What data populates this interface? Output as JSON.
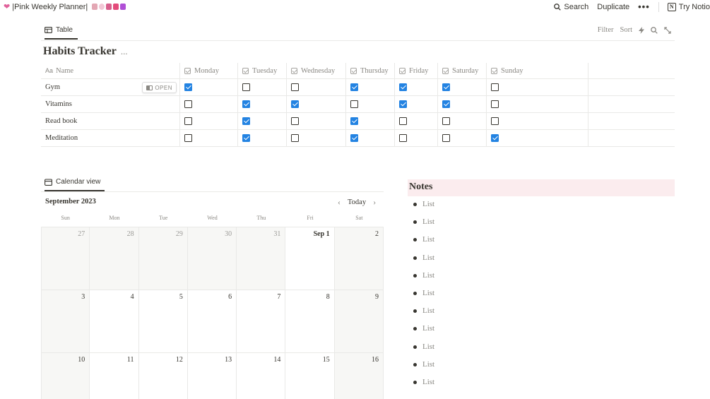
{
  "topbar": {
    "page_title": "|Pink Weekly Planner|",
    "actions": {
      "search": "Search",
      "duplicate": "Duplicate",
      "more": "•••",
      "try_notion": "Try Notio"
    }
  },
  "habits": {
    "view_tab": "Table",
    "title": "Habits Tracker",
    "title_more": "...",
    "toolbar": {
      "filter": "Filter",
      "sort": "Sort"
    },
    "name_header": "Name",
    "name_prefix": "Aa",
    "days": [
      "Monday",
      "Tuesday",
      "Wednesday",
      "Thursday",
      "Friday",
      "Saturday",
      "Sunday"
    ],
    "open_label": "OPEN",
    "rows": [
      {
        "name": "Gym",
        "checks": [
          true,
          false,
          false,
          true,
          true,
          true,
          false
        ]
      },
      {
        "name": "Vitamins",
        "checks": [
          false,
          true,
          true,
          false,
          true,
          true,
          false
        ]
      },
      {
        "name": "Read book",
        "checks": [
          false,
          true,
          false,
          true,
          false,
          false,
          false
        ]
      },
      {
        "name": "Meditation",
        "checks": [
          false,
          true,
          false,
          true,
          false,
          false,
          true
        ]
      }
    ]
  },
  "calendar": {
    "view_tab": "Calendar view",
    "month": "September 2023",
    "today": "Today",
    "weekdays": [
      "Sun",
      "Mon",
      "Tue",
      "Wed",
      "Thu",
      "Fri",
      "Sat"
    ],
    "weeks": [
      [
        "27",
        "28",
        "29",
        "30",
        "31",
        "Sep 1",
        "2"
      ],
      [
        "3",
        "4",
        "5",
        "6",
        "7",
        "8",
        "9"
      ],
      [
        "10",
        "11",
        "12",
        "13",
        "14",
        "15",
        "16"
      ]
    ]
  },
  "notes": {
    "title": "Notes",
    "items": [
      "List",
      "List",
      "List",
      "List",
      "List",
      "List",
      "List",
      "List",
      "List",
      "List",
      "List"
    ]
  },
  "colors": {
    "accent": "#2383e2",
    "notes_bg": "#fbecee",
    "heart": "#e0609a"
  }
}
